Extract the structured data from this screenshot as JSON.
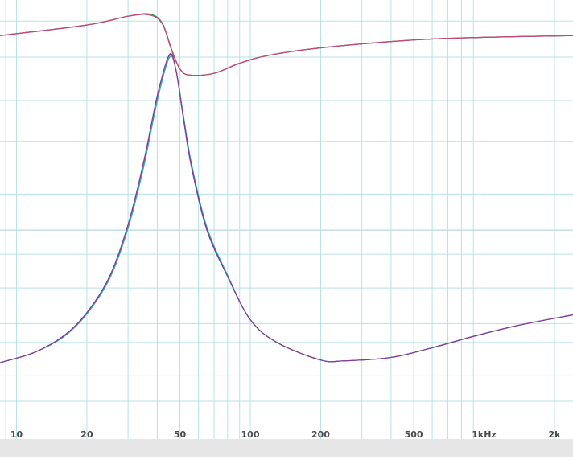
{
  "chart_data": {
    "type": "line",
    "title": "",
    "xlabel": "",
    "ylabel": "",
    "x_scale": "log",
    "xlim": [
      8.5,
      2400
    ],
    "ylim": [
      0,
      100
    ],
    "grid": true,
    "colors": {
      "background": "#ffffff",
      "grid": "#b8e2e6",
      "grid_major_h": "#a8d0d4",
      "tick_label": "#4a4a4a",
      "bottom_strip": "#e6e6e6"
    },
    "x_ticks": [
      {
        "value": 10,
        "label": "10"
      },
      {
        "value": 20,
        "label": "20"
      },
      {
        "value": 50,
        "label": "50"
      },
      {
        "value": 100,
        "label": "100"
      },
      {
        "value": 200,
        "label": "200"
      },
      {
        "value": 500,
        "label": "500"
      },
      {
        "value": 1000,
        "label": "1kHz"
      },
      {
        "value": 2000,
        "label": "2k"
      }
    ],
    "x_minor_grid": [
      9,
      30,
      40,
      60,
      70,
      80,
      90,
      300,
      400,
      600,
      700,
      800,
      900
    ],
    "y_grid": [
      95.2,
      87.0,
      77.1,
      67.8,
      55.8,
      47.6,
      42.1,
      34.4,
      26.3,
      22.0,
      14.4,
      8.6
    ],
    "y_major_grid": [
      47.6
    ],
    "series": [
      {
        "color": "#3a9a5a",
        "points": [
          [
            8.5,
            91.9
          ],
          [
            20,
            94.3
          ],
          [
            30,
            96.3
          ],
          [
            37,
            96.8
          ],
          [
            42,
            94.8
          ],
          [
            46,
            88.9
          ],
          [
            50,
            84.3
          ],
          [
            55,
            82.9
          ],
          [
            70,
            83.3
          ],
          [
            90,
            85.6
          ],
          [
            120,
            87.4
          ],
          [
            200,
            89.1
          ],
          [
            500,
            90.9
          ],
          [
            1000,
            91.5
          ],
          [
            2400,
            91.9
          ]
        ]
      },
      {
        "color": "#a03030",
        "points": [
          [
            8.5,
            91.9
          ],
          [
            20,
            94.3
          ],
          [
            30,
            96.3
          ],
          [
            37,
            96.6
          ],
          [
            42,
            94.6
          ],
          [
            46,
            88.7
          ],
          [
            50,
            84.3
          ],
          [
            55,
            82.9
          ],
          [
            70,
            83.3
          ],
          [
            90,
            85.6
          ],
          [
            120,
            87.4
          ],
          [
            200,
            89.1
          ],
          [
            500,
            90.9
          ],
          [
            1000,
            91.5
          ],
          [
            2400,
            91.9
          ]
        ]
      },
      {
        "color": "#c44a7a",
        "points": [
          [
            8.5,
            91.9
          ],
          [
            20,
            94.3
          ],
          [
            30,
            96.3
          ],
          [
            37,
            96.6
          ],
          [
            42,
            94.6
          ],
          [
            46,
            88.7
          ],
          [
            50,
            84.3
          ],
          [
            55,
            82.9
          ],
          [
            70,
            83.3
          ],
          [
            90,
            85.6
          ],
          [
            120,
            87.4
          ],
          [
            200,
            89.1
          ],
          [
            500,
            90.9
          ],
          [
            1000,
            91.5
          ],
          [
            2400,
            91.9
          ]
        ]
      },
      {
        "color": "#2ab0a0",
        "points": [
          [
            8.5,
            17.4
          ],
          [
            12,
            19.8
          ],
          [
            16,
            23.4
          ],
          [
            20,
            28.5
          ],
          [
            25,
            36.5
          ],
          [
            30,
            48.0
          ],
          [
            35,
            62.0
          ],
          [
            40,
            77.0
          ],
          [
            45,
            86.8
          ],
          [
            48,
            84.3
          ],
          [
            52,
            73.0
          ],
          [
            56,
            62.8
          ],
          [
            65,
            48.5
          ],
          [
            80,
            37.3
          ],
          [
            100,
            27.2
          ],
          [
            130,
            22.0
          ],
          [
            200,
            18.0
          ],
          [
            250,
            17.8
          ],
          [
            400,
            18.6
          ],
          [
            600,
            20.8
          ],
          [
            900,
            23.4
          ],
          [
            1400,
            25.9
          ],
          [
            2400,
            28.3
          ]
        ]
      },
      {
        "color": "#3a50c0",
        "points": [
          [
            8.5,
            17.4
          ],
          [
            12,
            19.8
          ],
          [
            16,
            23.6
          ],
          [
            20,
            28.8
          ],
          [
            25,
            37.0
          ],
          [
            30,
            48.8
          ],
          [
            35,
            63.0
          ],
          [
            40,
            78.2
          ],
          [
            45,
            87.3
          ],
          [
            48,
            84.3
          ],
          [
            52,
            72.5
          ],
          [
            56,
            62.3
          ],
          [
            65,
            48.0
          ],
          [
            80,
            37.0
          ],
          [
            100,
            27.2
          ],
          [
            130,
            22.0
          ],
          [
            200,
            18.0
          ],
          [
            250,
            17.8
          ],
          [
            400,
            18.6
          ],
          [
            600,
            20.8
          ],
          [
            900,
            23.4
          ],
          [
            1400,
            25.9
          ],
          [
            2400,
            28.3
          ]
        ]
      },
      {
        "color": "#8a3a9a",
        "points": [
          [
            8.5,
            17.4
          ],
          [
            12,
            19.8
          ],
          [
            16,
            23.6
          ],
          [
            20,
            28.8
          ],
          [
            25,
            37.0
          ],
          [
            30,
            48.8
          ],
          [
            35,
            63.2
          ],
          [
            40,
            78.0
          ],
          [
            45,
            87.5
          ],
          [
            48,
            84.3
          ],
          [
            52,
            72.2
          ],
          [
            56,
            62.0
          ],
          [
            65,
            47.8
          ],
          [
            80,
            37.0
          ],
          [
            100,
            27.2
          ],
          [
            130,
            22.0
          ],
          [
            200,
            18.0
          ],
          [
            250,
            17.8
          ],
          [
            400,
            18.6
          ],
          [
            600,
            20.8
          ],
          [
            900,
            23.4
          ],
          [
            1400,
            25.9
          ],
          [
            2400,
            28.3
          ]
        ]
      }
    ]
  }
}
